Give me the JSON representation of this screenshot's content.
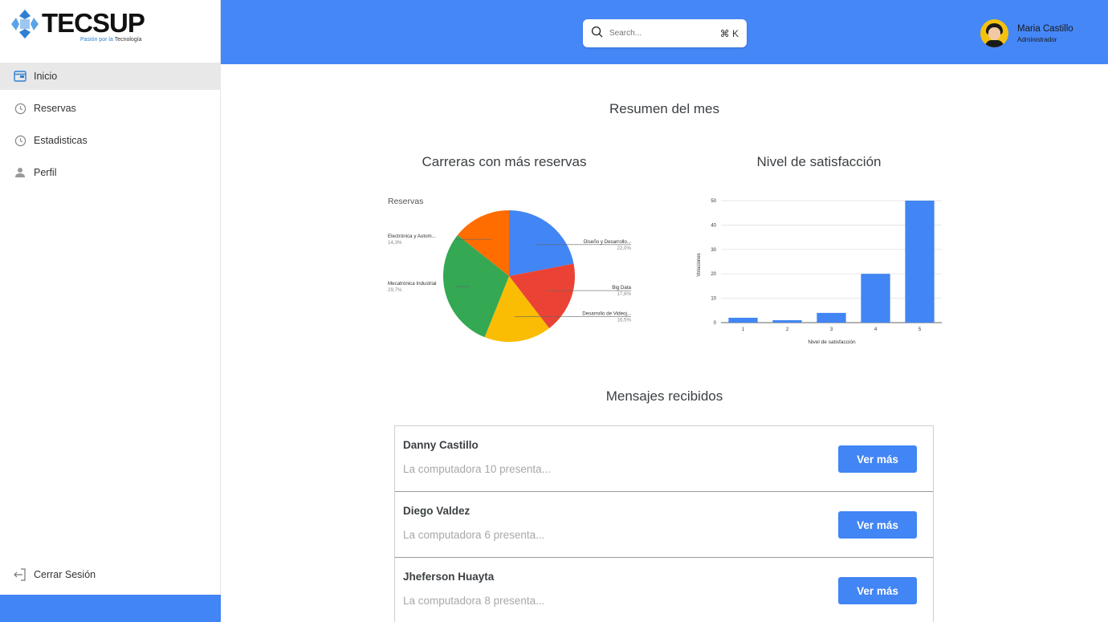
{
  "brand": {
    "name": "TECSUP",
    "tagline_prefix": "Pasión por la ",
    "tagline_emph": "Tecnología"
  },
  "sidebar": {
    "items": [
      {
        "label": "Inicio",
        "icon": "window-icon",
        "active": true
      },
      {
        "label": "Reservas",
        "icon": "clock-icon",
        "active": false
      },
      {
        "label": "Estadisticas",
        "icon": "clock-icon",
        "active": false
      },
      {
        "label": "Perfil",
        "icon": "person-icon",
        "active": false
      }
    ],
    "logout_label": "Cerrar Sesión"
  },
  "header": {
    "search": {
      "placeholder": "Search...",
      "shortcut": "⌘ K"
    },
    "user": {
      "name": "Maria Castillo",
      "role": "Administrador"
    }
  },
  "main": {
    "title": "Resumen del mes",
    "pie_title": "Carreras con más reservas",
    "bar_title": "Nivel de satisfacción",
    "messages_title": "Mensajes recibidos"
  },
  "chart_data": [
    {
      "type": "pie",
      "title": "Reservas",
      "slices": [
        {
          "label": "Diseño y Desarrollo...",
          "value": 22.0,
          "pct": "22,0%",
          "color": "#4285f4"
        },
        {
          "label": "Big Data",
          "value": 17.6,
          "pct": "17,6%",
          "color": "#ea4335"
        },
        {
          "label": "Desarrollo de Videoj...",
          "value": 16.5,
          "pct": "16,5%",
          "color": "#fbbc04"
        },
        {
          "label": "Mecatrónica Industrial",
          "value": 29.7,
          "pct": "29,7%",
          "color": "#34a853"
        },
        {
          "label": "Electrónica y Autom...",
          "value": 14.3,
          "pct": "14,3%",
          "color": "#ff6d01"
        }
      ]
    },
    {
      "type": "bar",
      "categories": [
        "1",
        "2",
        "3",
        "4",
        "5"
      ],
      "values": [
        2,
        1,
        4,
        20,
        50
      ],
      "xlabel": "Nivel de satisfacción",
      "ylabel": "Votaciones",
      "ylim": [
        0,
        50
      ],
      "yticks": [
        0,
        10,
        20,
        30,
        40,
        50
      ],
      "color": "#4285f4",
      "grid": true
    }
  ],
  "messages": [
    {
      "name": "Danny Castillo",
      "preview": "La computadora 10 presenta...",
      "button": "Ver más"
    },
    {
      "name": "Diego Valdez",
      "preview": "La computadora 6 presenta...",
      "button": "Ver más"
    },
    {
      "name": "Jheferson Huayta",
      "preview": "La computadora 8 presenta...",
      "button": "Ver más"
    }
  ]
}
